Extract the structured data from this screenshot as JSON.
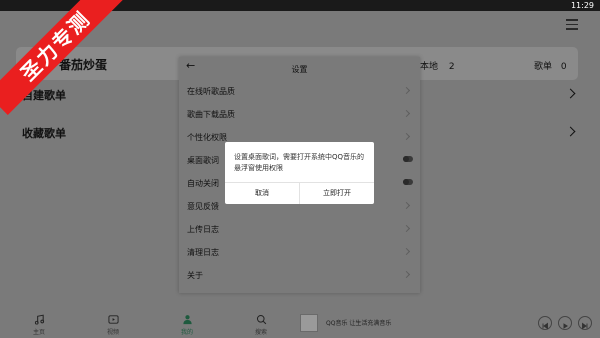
{
  "status_bar": {
    "time": "11:29"
  },
  "profile": {
    "name": "番茄炒蛋",
    "local_label": "本地",
    "local_count": "2",
    "playlist_label": "歌单",
    "playlist_count": "0"
  },
  "sections": {
    "created": "自建歌单",
    "collected": "收藏歌单"
  },
  "bottom_nav": [
    {
      "label": "主页",
      "icon": "music-note-icon"
    },
    {
      "label": "视频",
      "icon": "video-icon"
    },
    {
      "label": "我的",
      "icon": "person-icon"
    },
    {
      "label": "搜索",
      "icon": "search-icon"
    }
  ],
  "mini_player": {
    "text": "QQ音乐 让生活充满音乐"
  },
  "settings": {
    "title": "设置",
    "rows": [
      {
        "label": "在线听歌品质",
        "control": "chevron"
      },
      {
        "label": "歌曲下载品质",
        "control": "chevron"
      },
      {
        "label": "个性化权限",
        "control": "chevron"
      },
      {
        "label": "桌面歌词",
        "control": "toggle"
      },
      {
        "label": "自动关闭",
        "control": "toggle"
      },
      {
        "label": "意见反馈",
        "control": "chevron"
      },
      {
        "label": "上传日志",
        "control": "chevron"
      },
      {
        "label": "清理日志",
        "control": "chevron"
      },
      {
        "label": "关于",
        "control": "chevron"
      }
    ]
  },
  "dialog": {
    "message": "设置桌面歌词，需要打开系统中QQ音乐的悬浮窗使用权限",
    "cancel": "取消",
    "confirm": "立即打开"
  },
  "watermark": {
    "text": "圣力专测"
  },
  "colors": {
    "watermark_red": "#ea1f1f",
    "accent_green": "#31c27c"
  }
}
